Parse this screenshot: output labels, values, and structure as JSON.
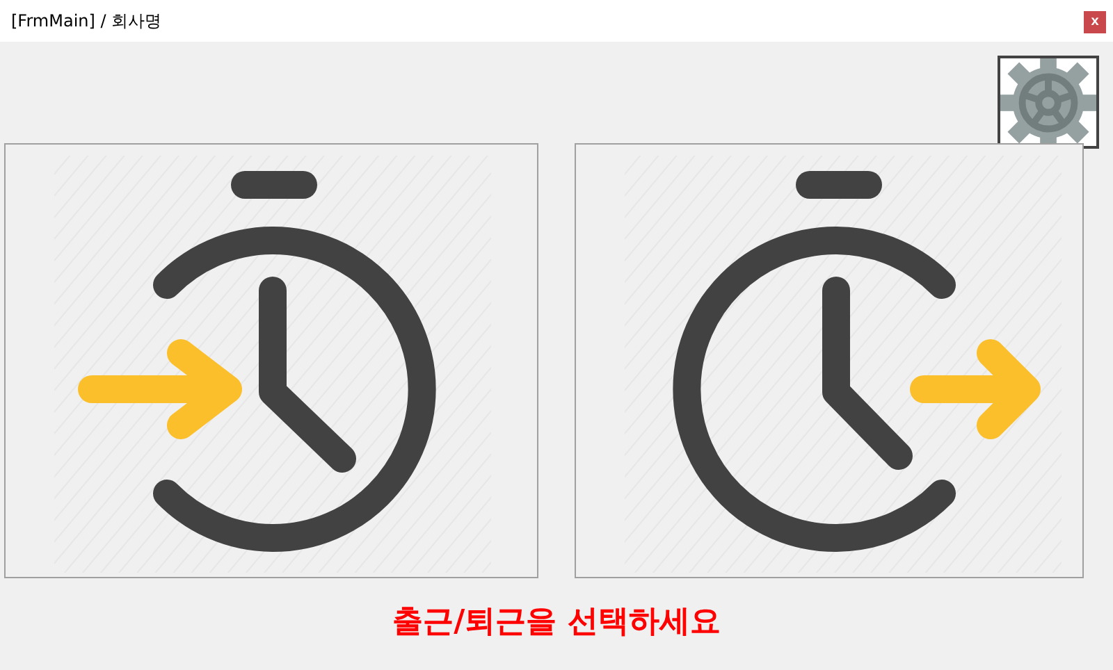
{
  "window": {
    "title": "[FrmMain] / 회사명",
    "close": "x"
  },
  "choices": [
    {
      "kind": "clock-in"
    },
    {
      "kind": "clock-out"
    }
  ],
  "message": "출근/퇴근을 선택하세요"
}
